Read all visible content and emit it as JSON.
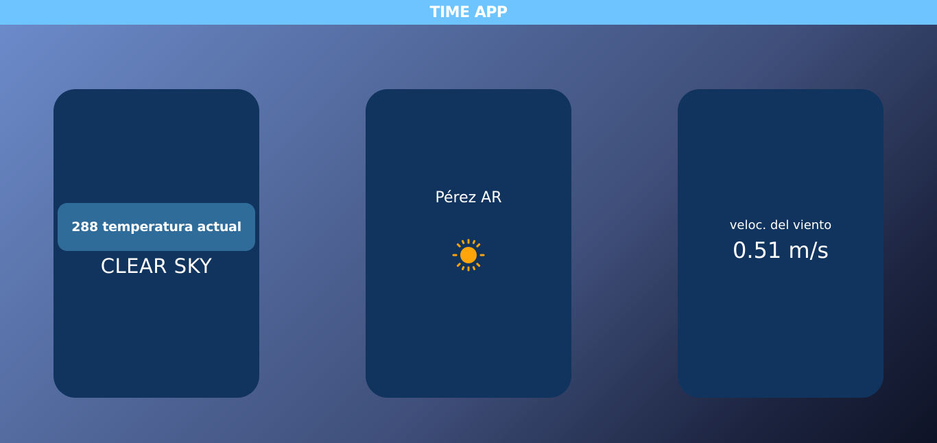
{
  "header": {
    "title": "TIME APP",
    "background_color": "#6ec4ff"
  },
  "cards": {
    "temperature": {
      "badge_text": "288 temperatura actual",
      "description": "CLEAR SKY"
    },
    "location": {
      "city": "Pérez AR",
      "weather_icon": "sun-icon",
      "icon_color": "#ffa50a"
    },
    "wind": {
      "label": "veloc. del viento",
      "value": "0.51 m/s"
    }
  },
  "colors": {
    "card_background": "#11345f",
    "badge_background": "#2f6c9a"
  }
}
